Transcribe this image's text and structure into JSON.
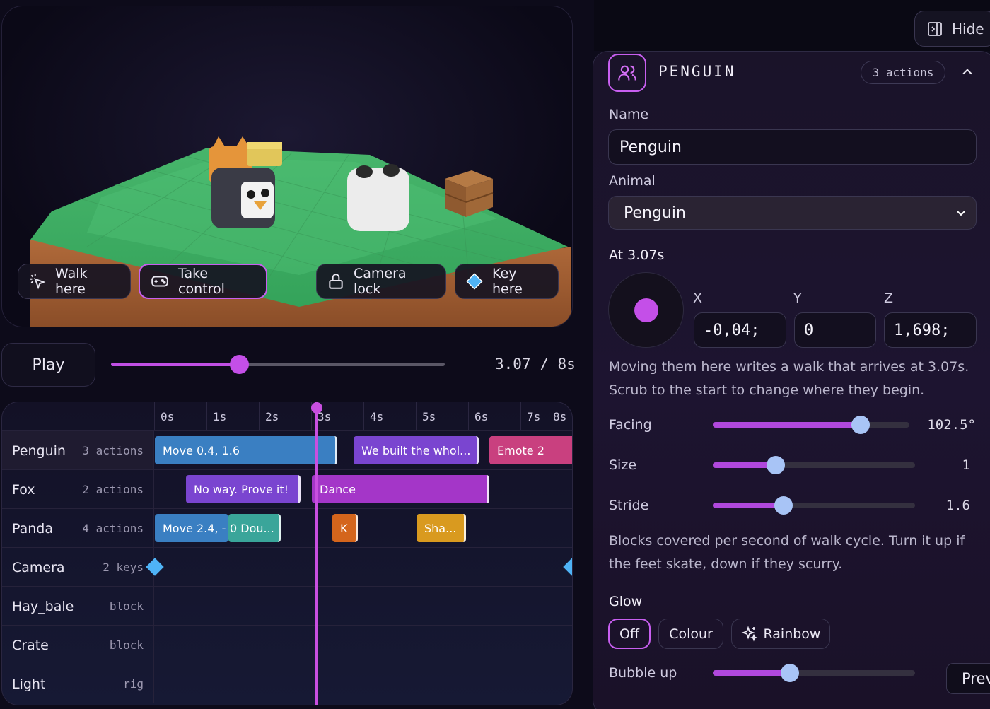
{
  "viewport": {
    "buttons": {
      "walk_here": "Walk here",
      "take_control": "Take control",
      "camera_lock": "Camera lock",
      "key_here": "Key here"
    }
  },
  "playback": {
    "play_label": "Play",
    "progress": 0.384,
    "time_readout": "3.07 / 8s"
  },
  "timeline": {
    "ticks": [
      "0s",
      "1s",
      "2s",
      "3s",
      "4s",
      "5s",
      "6s",
      "7s",
      "8s"
    ],
    "rows": [
      {
        "name": "Penguin",
        "count": "3 actions"
      },
      {
        "name": "Fox",
        "count": "2 actions"
      },
      {
        "name": "Panda",
        "count": "4 actions"
      },
      {
        "name": "Camera",
        "count": "2 keys"
      },
      {
        "name": "Hay_bale",
        "count": "block"
      },
      {
        "name": "Crate",
        "count": "block"
      },
      {
        "name": "Light",
        "count": "rig"
      }
    ],
    "clips": {
      "penguin_move": "Move 0.4, 1.6",
      "penguin_say": "We built the whol...",
      "penguin_emote": "Emote 2",
      "fox_say": "No way. Prove it!",
      "fox_dance": "Dance",
      "panda_move": "Move 2.4, -",
      "panda_dou": "0 Dou...",
      "panda_k": "K",
      "panda_sha": "Sha..."
    },
    "colors": {
      "blue": "#3a7fc2",
      "purple": "#7a45d0",
      "magenta": "#c9407f",
      "violet": "#a436c8",
      "teal": "#3aa59a",
      "orange": "#d4651c",
      "gold": "#d99a1f",
      "key": "#4fb3f6"
    }
  },
  "panel": {
    "hide_label": "Hide",
    "entity_title": "PENGUIN",
    "actions_badge": "3 actions",
    "name_label": "Name",
    "name_value": "Penguin",
    "animal_label": "Animal",
    "animal_value": "Penguin",
    "at_label": "At 3.07s",
    "axes": {
      "x": "X",
      "y": "Y",
      "z": "Z"
    },
    "coords": {
      "x": "-0,04;",
      "y": "0",
      "z": "1,698;"
    },
    "move_hint": "Moving them here writes a walk that arrives at 3.07s. Scrub to the start to change where they begin.",
    "sliders": [
      {
        "label": "Facing",
        "value": "102.5°",
        "fraction": 0.75
      },
      {
        "label": "Size",
        "value": "1",
        "fraction": 0.31
      },
      {
        "label": "Stride",
        "value": "1.6",
        "fraction": 0.35
      }
    ],
    "stride_hint": "Blocks covered per second of walk cycle. Turn it up if the feet skate, down if they scurry.",
    "glow_label": "Glow",
    "glow_options": [
      "Off",
      "Colour",
      "Rainbow"
    ],
    "bubble_label": "Bubble up",
    "bubble_fraction": 0.38,
    "preview_label": "Prev"
  }
}
